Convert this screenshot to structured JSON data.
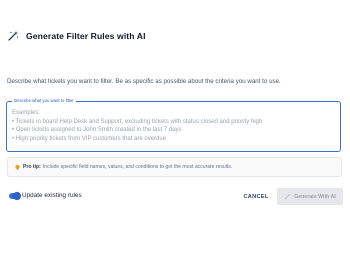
{
  "dialog": {
    "title": "Generate Filter Rules with AI",
    "description": "Describe what tickets you want to filter. Be as specific as possible about the criteria you want to use."
  },
  "filter_field": {
    "legend": "Describe what you want to filter",
    "placeholder": "Examples:\n• Tickets in board Help Desk and Support, excluding tickets with status closed and priority high\n• Open tickets assigned to John Smith created in the last 7 days\n• High priority tickets from VIP customers that are overdue",
    "value": ""
  },
  "tip": {
    "label": "Pro tip:",
    "text": "Include specific field names, values, and conditions to get the most accurate results."
  },
  "footer": {
    "toggle_label": "Update existing rules",
    "toggle_on": true,
    "cancel_label": "CANCEL",
    "generate_label": "Generate With AI"
  },
  "colors": {
    "accent": "#3b6fd6",
    "disabled_bg": "#e5e7eb",
    "disabled_text": "#9ca3af"
  },
  "icons": {
    "title_icon": "magic-wand-icon",
    "tip_icon": "lightbulb-icon",
    "button_icon": "magic-wand-icon"
  }
}
